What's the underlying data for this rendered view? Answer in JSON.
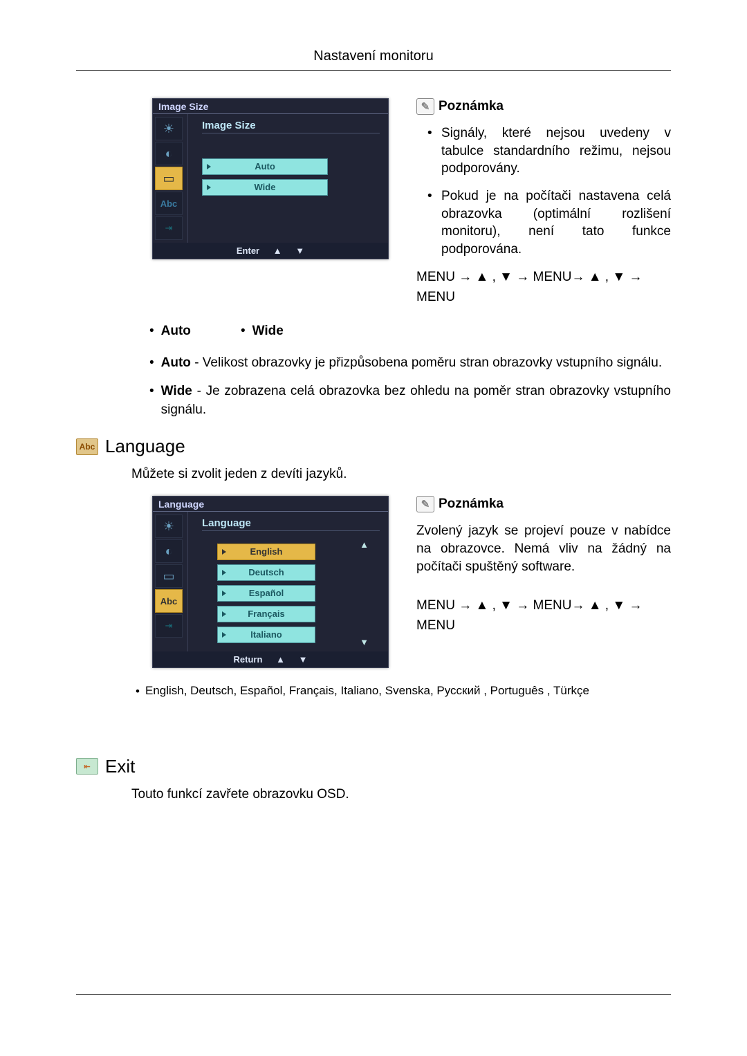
{
  "header": "Nastavení monitoru",
  "osd_image_size": {
    "title": "Image Size",
    "section": "Image Size",
    "options": [
      "Auto",
      "Wide"
    ],
    "foot_label": "Enter",
    "foot_up": "▲",
    "foot_down": "▼",
    "side_icons": [
      "sun",
      "palette",
      "square",
      "abc",
      "exit"
    ]
  },
  "note1": {
    "title": "Poznámka",
    "items": [
      "Signály, které nejsou uvedeny v tabulce standardního režimu, nejsou podporovány.",
      "Pokud je na počítači nastavena celá obrazovka (optimální rozlišení monitoru), není tato funkce podporována."
    ],
    "nav": "MENU → ▲ , ▼ → MENU→ ▲ , ▼ → MENU"
  },
  "inline_bullets": {
    "items": [
      "Auto",
      "Wide"
    ]
  },
  "desc_bullets": [
    {
      "label": "Auto",
      "text": " - Velikost obrazovky je přizpůsobena poměru stran obrazovky vstupního signálu."
    },
    {
      "label": "Wide",
      "text": " - Je zobrazena celá obrazovka bez ohledu na poměr stran obrazovky vstupního signálu."
    }
  ],
  "language": {
    "title": "Language",
    "intro": "Můžete si zvolit jeden z devíti jazyků.",
    "osd": {
      "title": "Language",
      "section": "Language",
      "options": [
        "English",
        "Deutsch",
        "Español",
        "Français",
        "Italiano"
      ],
      "selected_index": 0,
      "foot_label": "Return",
      "foot_up": "▲",
      "foot_down": "▼"
    },
    "note": {
      "title": "Poznámka",
      "text": "Zvolený jazyk se projeví pouze v nabídce na obrazovce. Nemá vliv na žádný na počítači spuštěný software.",
      "nav": "MENU → ▲ , ▼ → MENU→ ▲ , ▼ → MENU"
    },
    "list_line": "English, Deutsch, Español, Français,  Italiano, Svenska, Русский , Português , Türkçe"
  },
  "exit": {
    "title": "Exit",
    "text": "Touto funkcí zavřete obrazovku OSD."
  }
}
